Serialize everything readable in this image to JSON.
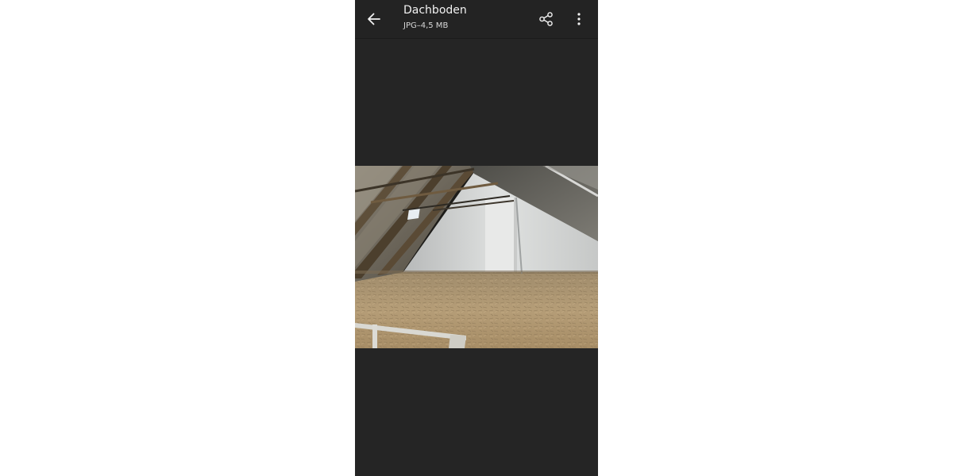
{
  "header": {
    "title": "Dachboden",
    "subtitle": "JPG–4,5 MB"
  },
  "icons": {
    "back": "arrow-left-icon",
    "share": "share-icon",
    "more": "more-vertical-icon"
  },
  "colors": {
    "background": "#252525",
    "appbar": "#232323",
    "text": "#f2f2f2"
  }
}
